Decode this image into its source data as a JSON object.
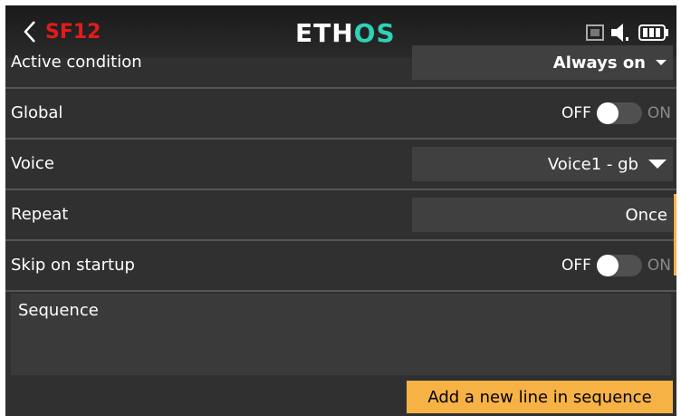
{
  "header": {
    "title": "SF12",
    "logo_main": "ETH",
    "logo_accent": "OS",
    "icons": [
      "back-icon",
      "sd-card-icon",
      "speaker-icon",
      "battery-icon"
    ],
    "colors": {
      "title": "#e41b1b",
      "logo_accent": "#2fd1b8"
    }
  },
  "rows": [
    {
      "label": "Active condition",
      "value": "Always on",
      "type": "dropdown"
    },
    {
      "label": "Global",
      "type": "toggle",
      "off": "OFF",
      "on": "ON",
      "state": "off"
    },
    {
      "label": "Voice",
      "value": "Voice1 - gb",
      "type": "dropdown"
    },
    {
      "label": "Repeat",
      "value": "Once",
      "type": "choice"
    },
    {
      "label": "Skip on startup",
      "type": "toggle",
      "off": "OFF",
      "on": "ON",
      "state": "off"
    }
  ],
  "sequence": {
    "label": "Sequence"
  },
  "add_button": {
    "label": "Add a new line in sequence",
    "color": "#f7b246"
  }
}
